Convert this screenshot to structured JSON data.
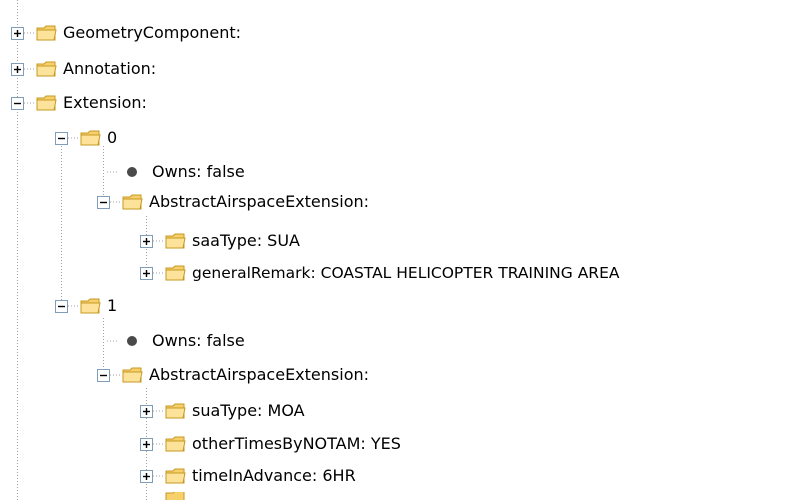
{
  "colors": {
    "guide_line": "#a0a0a0",
    "toggle_border": "#7f9db9",
    "toggle_fill": "#ffffff",
    "toggle_glyph": "#000000",
    "folder_fill": "#fde29a",
    "folder_tab": "#f7cf6b",
    "folder_outline": "#c59a21",
    "bullet": "#4a4a4a",
    "text": "#000000"
  },
  "icons": {
    "expand": "plus-box-icon",
    "collapse": "minus-box-icon",
    "folder": "folder-icon",
    "leaf": "bullet-icon"
  },
  "tree": {
    "nodes": [
      {
        "label": "GeometryComponent:",
        "toggle": "expand",
        "type": "folder"
      },
      {
        "label": "Annotation:",
        "toggle": "expand",
        "type": "folder"
      },
      {
        "label": "Extension:",
        "toggle": "collapse",
        "type": "folder"
      },
      {
        "label": "0",
        "toggle": "collapse",
        "type": "folder"
      },
      {
        "label": "Owns: false",
        "toggle": "none",
        "type": "leaf"
      },
      {
        "label": "AbstractAirspaceExtension:",
        "toggle": "collapse",
        "type": "folder"
      },
      {
        "label": "saaType: SUA",
        "toggle": "expand",
        "type": "folder"
      },
      {
        "label": "generalRemark: COASTAL HELICOPTER TRAINING AREA",
        "toggle": "expand",
        "type": "folder"
      },
      {
        "label": "1",
        "toggle": "collapse",
        "type": "folder"
      },
      {
        "label": "Owns: false",
        "toggle": "none",
        "type": "leaf"
      },
      {
        "label": "AbstractAirspaceExtension:",
        "toggle": "collapse",
        "type": "folder"
      },
      {
        "label": "suaType: MOA",
        "toggle": "expand",
        "type": "folder"
      },
      {
        "label": "otherTimesByNOTAM: YES",
        "toggle": "expand",
        "type": "folder"
      },
      {
        "label": "timeInAdvance: 6HR",
        "toggle": "expand",
        "type": "folder"
      }
    ]
  }
}
